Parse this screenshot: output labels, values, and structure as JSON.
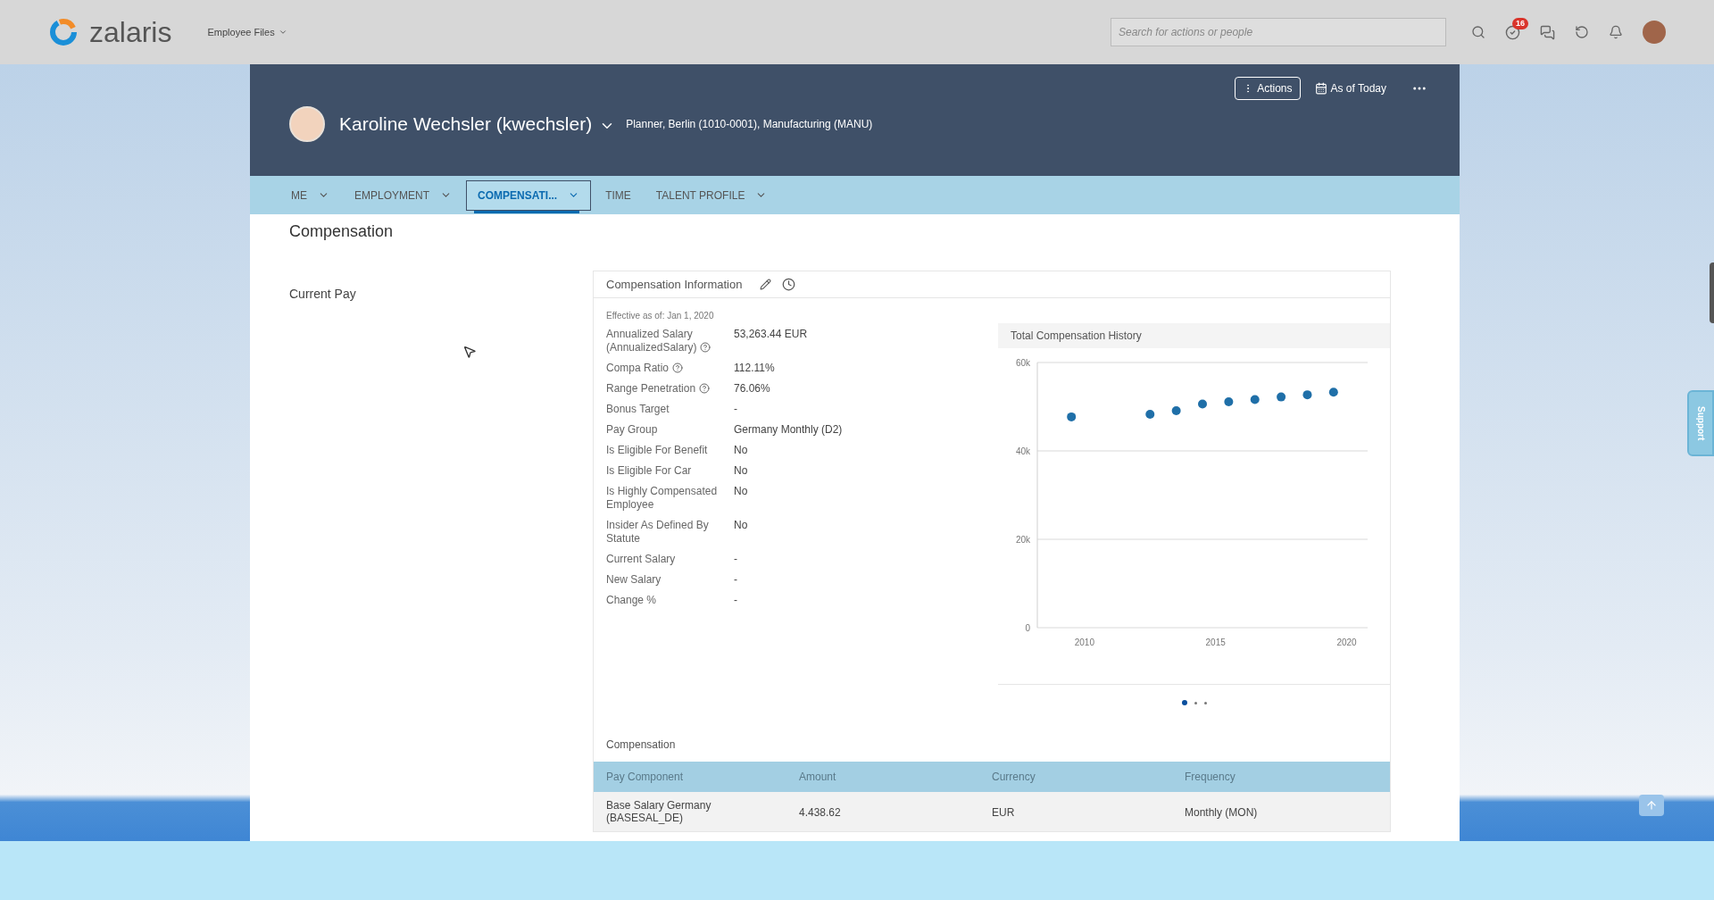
{
  "top_bar": {
    "logo": "zalaris",
    "module_menu": "Employee Files",
    "search": {
      "placeholder": "Search for actions or people"
    },
    "todo_badge": "16"
  },
  "header": {
    "name": "Karoline Wechsler (kwechsler)",
    "subtitle": "Planner, Berlin (1010-0001), Manufacturing (MANU)",
    "actions_button": "Actions",
    "date_button": "As of Today"
  },
  "tabs": [
    {
      "label": "ME",
      "has_menu": true,
      "selected": false
    },
    {
      "label": "EMPLOYMENT",
      "has_menu": true,
      "selected": false
    },
    {
      "label": "COMPENSATI...",
      "has_menu": true,
      "selected": true
    },
    {
      "label": "TIME",
      "has_menu": false,
      "selected": false
    },
    {
      "label": "TALENT PROFILE",
      "has_menu": true,
      "selected": false
    }
  ],
  "page_title": "Compensation",
  "section_label": "Current Pay",
  "compensation_info": {
    "title": "Compensation Information",
    "effective": "Effective as of: Jan 1, 2020",
    "fields": [
      {
        "label": "Annualized Salary (AnnualizedSalary)",
        "help": true,
        "value": "53,263.44 EUR"
      },
      {
        "label": "Compa Ratio",
        "help": true,
        "value": "112.11%"
      },
      {
        "label": "Range Penetration",
        "help": true,
        "value": "76.06%"
      },
      {
        "label": "Bonus Target",
        "help": false,
        "value": "-"
      },
      {
        "label": "Pay Group",
        "help": false,
        "value": "Germany Monthly (D2)"
      },
      {
        "label": "Is Eligible For Benefit",
        "help": false,
        "value": "No"
      },
      {
        "label": "Is Eligible For Car",
        "help": false,
        "value": "No"
      },
      {
        "label": "Is Highly Compensated Employee",
        "help": false,
        "value": "No"
      },
      {
        "label": "Insider As Defined By Statute",
        "help": false,
        "value": "No"
      },
      {
        "label": "Current Salary",
        "help": false,
        "value": "-"
      },
      {
        "label": "New Salary",
        "help": false,
        "value": "-"
      },
      {
        "label": "Change %",
        "help": false,
        "value": "-"
      }
    ]
  },
  "chart": {
    "title": "Total Compensation History",
    "chart_data": {
      "type": "scatter",
      "x": [
        2009.5,
        2012.5,
        2013.5,
        2014.5,
        2015.5,
        2016.5,
        2017.5,
        2018.5,
        2019.5
      ],
      "series": [
        {
          "color": "#1f6fa8",
          "values": [
            47700,
            48300,
            49100,
            50600,
            51100,
            51600,
            52200,
            52700,
            53300
          ]
        }
      ],
      "xlim": [
        2008.2,
        2020.8
      ],
      "ylim": [
        0,
        60000
      ],
      "xticks": [
        2010,
        2015,
        2020
      ],
      "yticks": [
        {
          "value": 0,
          "label": "0"
        },
        {
          "value": 20000,
          "label": "20k"
        },
        {
          "value": 40000,
          "label": "40k"
        },
        {
          "value": 60000,
          "label": "60k"
        }
      ]
    },
    "pages": [
      {
        "selected": true
      },
      {
        "selected": false
      },
      {
        "selected": false
      }
    ]
  },
  "compensation_table": {
    "title": "Compensation",
    "columns": [
      "Pay Component",
      "Amount",
      "Currency",
      "Frequency"
    ],
    "rows": [
      [
        "Base Salary Germany (BASESAL_DE)",
        "4.438.62",
        "EUR",
        "Monthly (MON)"
      ]
    ]
  },
  "support_tab": "Support"
}
